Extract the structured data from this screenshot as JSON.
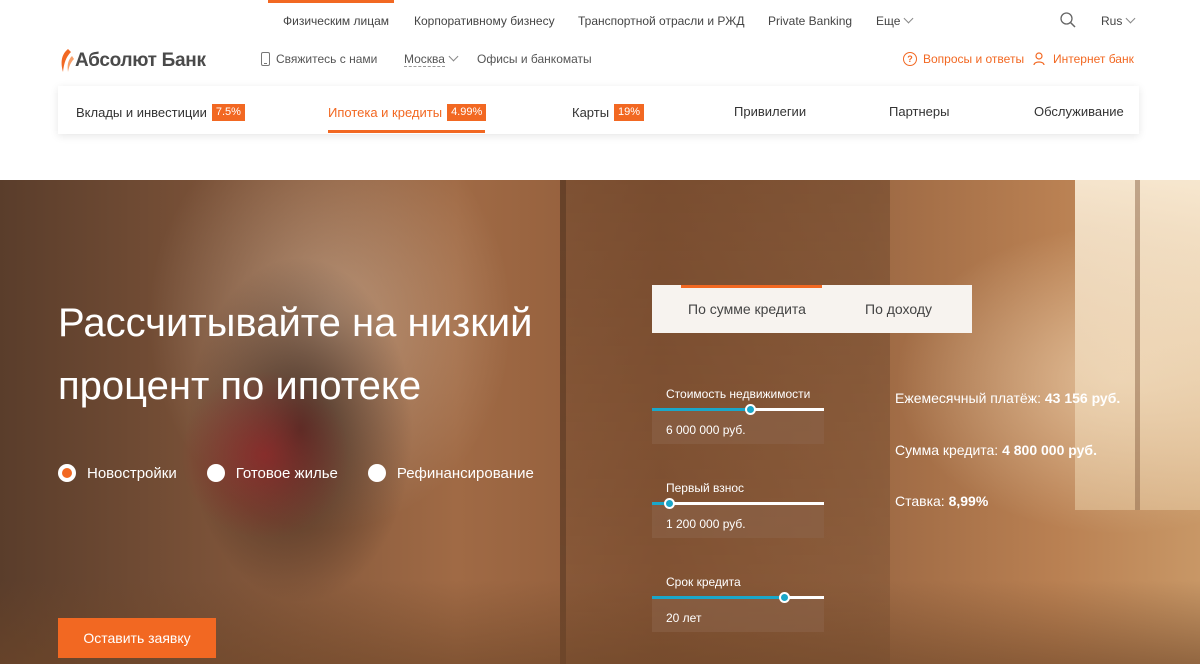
{
  "top_nav": {
    "items": [
      {
        "label": "Физическим лицам"
      },
      {
        "label": "Корпоративному бизнесу"
      },
      {
        "label": "Транспортной отрасли и РЖД"
      },
      {
        "label": "Private Banking"
      },
      {
        "label": "Еще"
      }
    ],
    "language": "Rus"
  },
  "header": {
    "logo_text": "Абсолют Банк",
    "contact": "Свяжитесь с нами",
    "city": "Москва",
    "offices": "Офисы и банкоматы",
    "faq": "Вопросы и ответы",
    "internet_bank": "Интернет банк"
  },
  "main_nav": {
    "items": [
      {
        "label": "Вклады и инвестиции",
        "badge": "7.5%"
      },
      {
        "label": "Ипотека и кредиты",
        "badge": "4.99%"
      },
      {
        "label": "Карты",
        "badge": "19%"
      },
      {
        "label": "Привилегии"
      },
      {
        "label": "Партнеры"
      },
      {
        "label": "Обслуживание"
      }
    ]
  },
  "hero": {
    "title": "Рассчитывайте на низкий процент по ипотеке",
    "options": [
      {
        "label": "Новостройки",
        "selected": true
      },
      {
        "label": "Готовое жилье",
        "selected": false
      },
      {
        "label": "Рефинансирование",
        "selected": false
      }
    ],
    "apply_button": "Оставить заявку"
  },
  "calculator": {
    "tabs": [
      {
        "label": "По сумме кредита",
        "active": true
      },
      {
        "label": "По доходу",
        "active": false
      }
    ],
    "fields": [
      {
        "label": "Стоимость недвижимости",
        "value": "6 000 000 руб.",
        "slider_level": 0.57
      },
      {
        "label": "Первый взнос",
        "value": "1 200 000 руб.",
        "slider_level": 0.1
      },
      {
        "label": "Срок кредита",
        "value": "20 лет",
        "slider_level": 0.77
      }
    ],
    "results": {
      "monthly_label": "Ежемесячный платёж:",
      "monthly_value": "43 156 руб.",
      "amount_label": "Сумма кредита:",
      "amount_value": "4 800 000 руб.",
      "rate_label": "Ставка:",
      "rate_value": "8,99%"
    }
  },
  "colors": {
    "accent": "#f26822",
    "slider": "#1aa7c9"
  }
}
